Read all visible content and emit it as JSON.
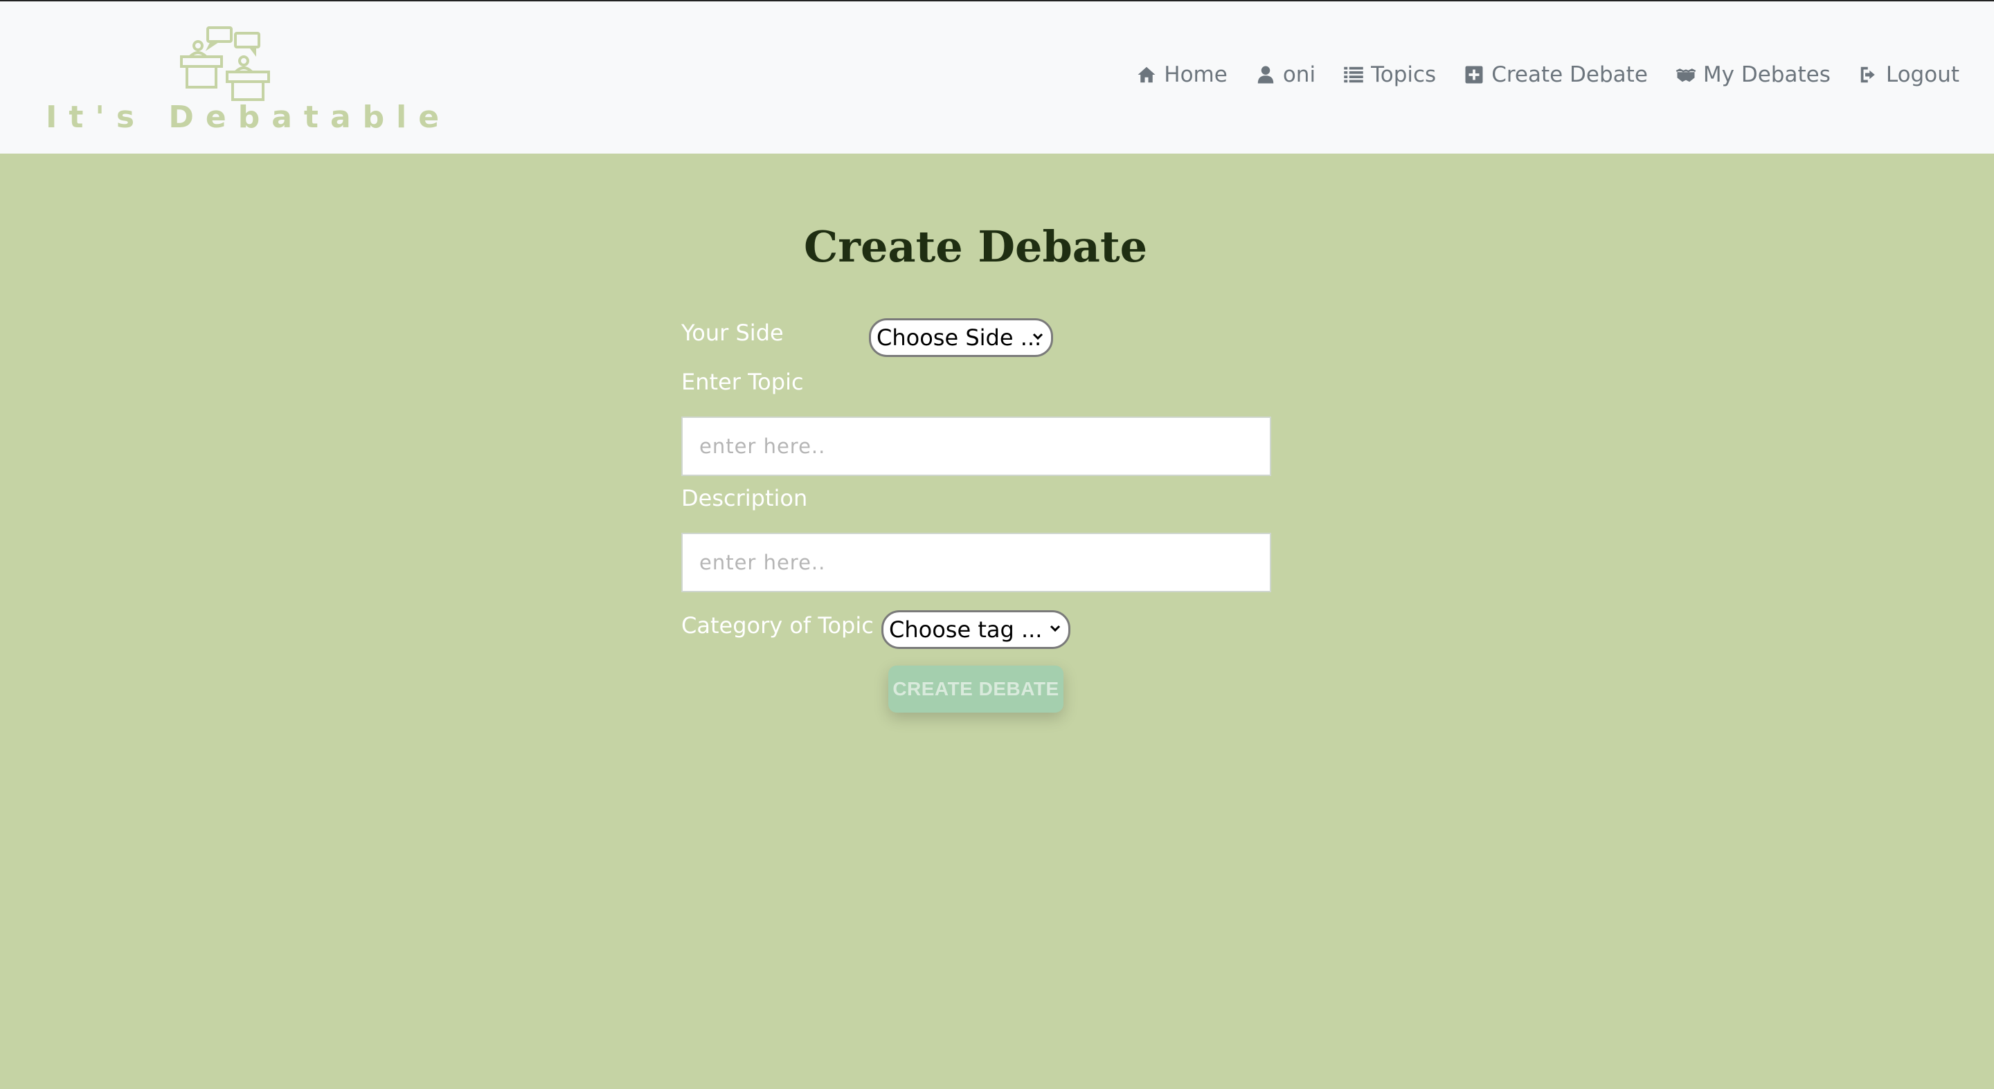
{
  "brand": {
    "logo_text": "It's Debatable",
    "logo_icon": "debate-podium-icon",
    "color": "#c5d3a4"
  },
  "nav": {
    "items": [
      {
        "label": "Home",
        "icon": "home-icon"
      },
      {
        "label": "oni",
        "icon": "user-icon"
      },
      {
        "label": "Topics",
        "icon": "list-icon"
      },
      {
        "label": "Create Debate",
        "icon": "plus-square-icon"
      },
      {
        "label": "My Debates",
        "icon": "handshake-icon"
      },
      {
        "label": "Logout",
        "icon": "sign-out-icon"
      }
    ]
  },
  "form": {
    "title": "Create Debate",
    "side_label": "Your Side",
    "side_select_value": "Choose Side ...",
    "topic_label": "Enter Topic",
    "topic_placeholder": "enter here..",
    "description_label": "Description",
    "description_placeholder": "enter here..",
    "category_label": "Category of Topic",
    "category_select_value": "Choose tag ...",
    "submit_label": "CREATE DEBATE"
  },
  "colors": {
    "page_background": "#c5d3a4",
    "navbar_background": "#f8f9fa",
    "heading": "#1f2e12",
    "button": "#a4cfae"
  }
}
